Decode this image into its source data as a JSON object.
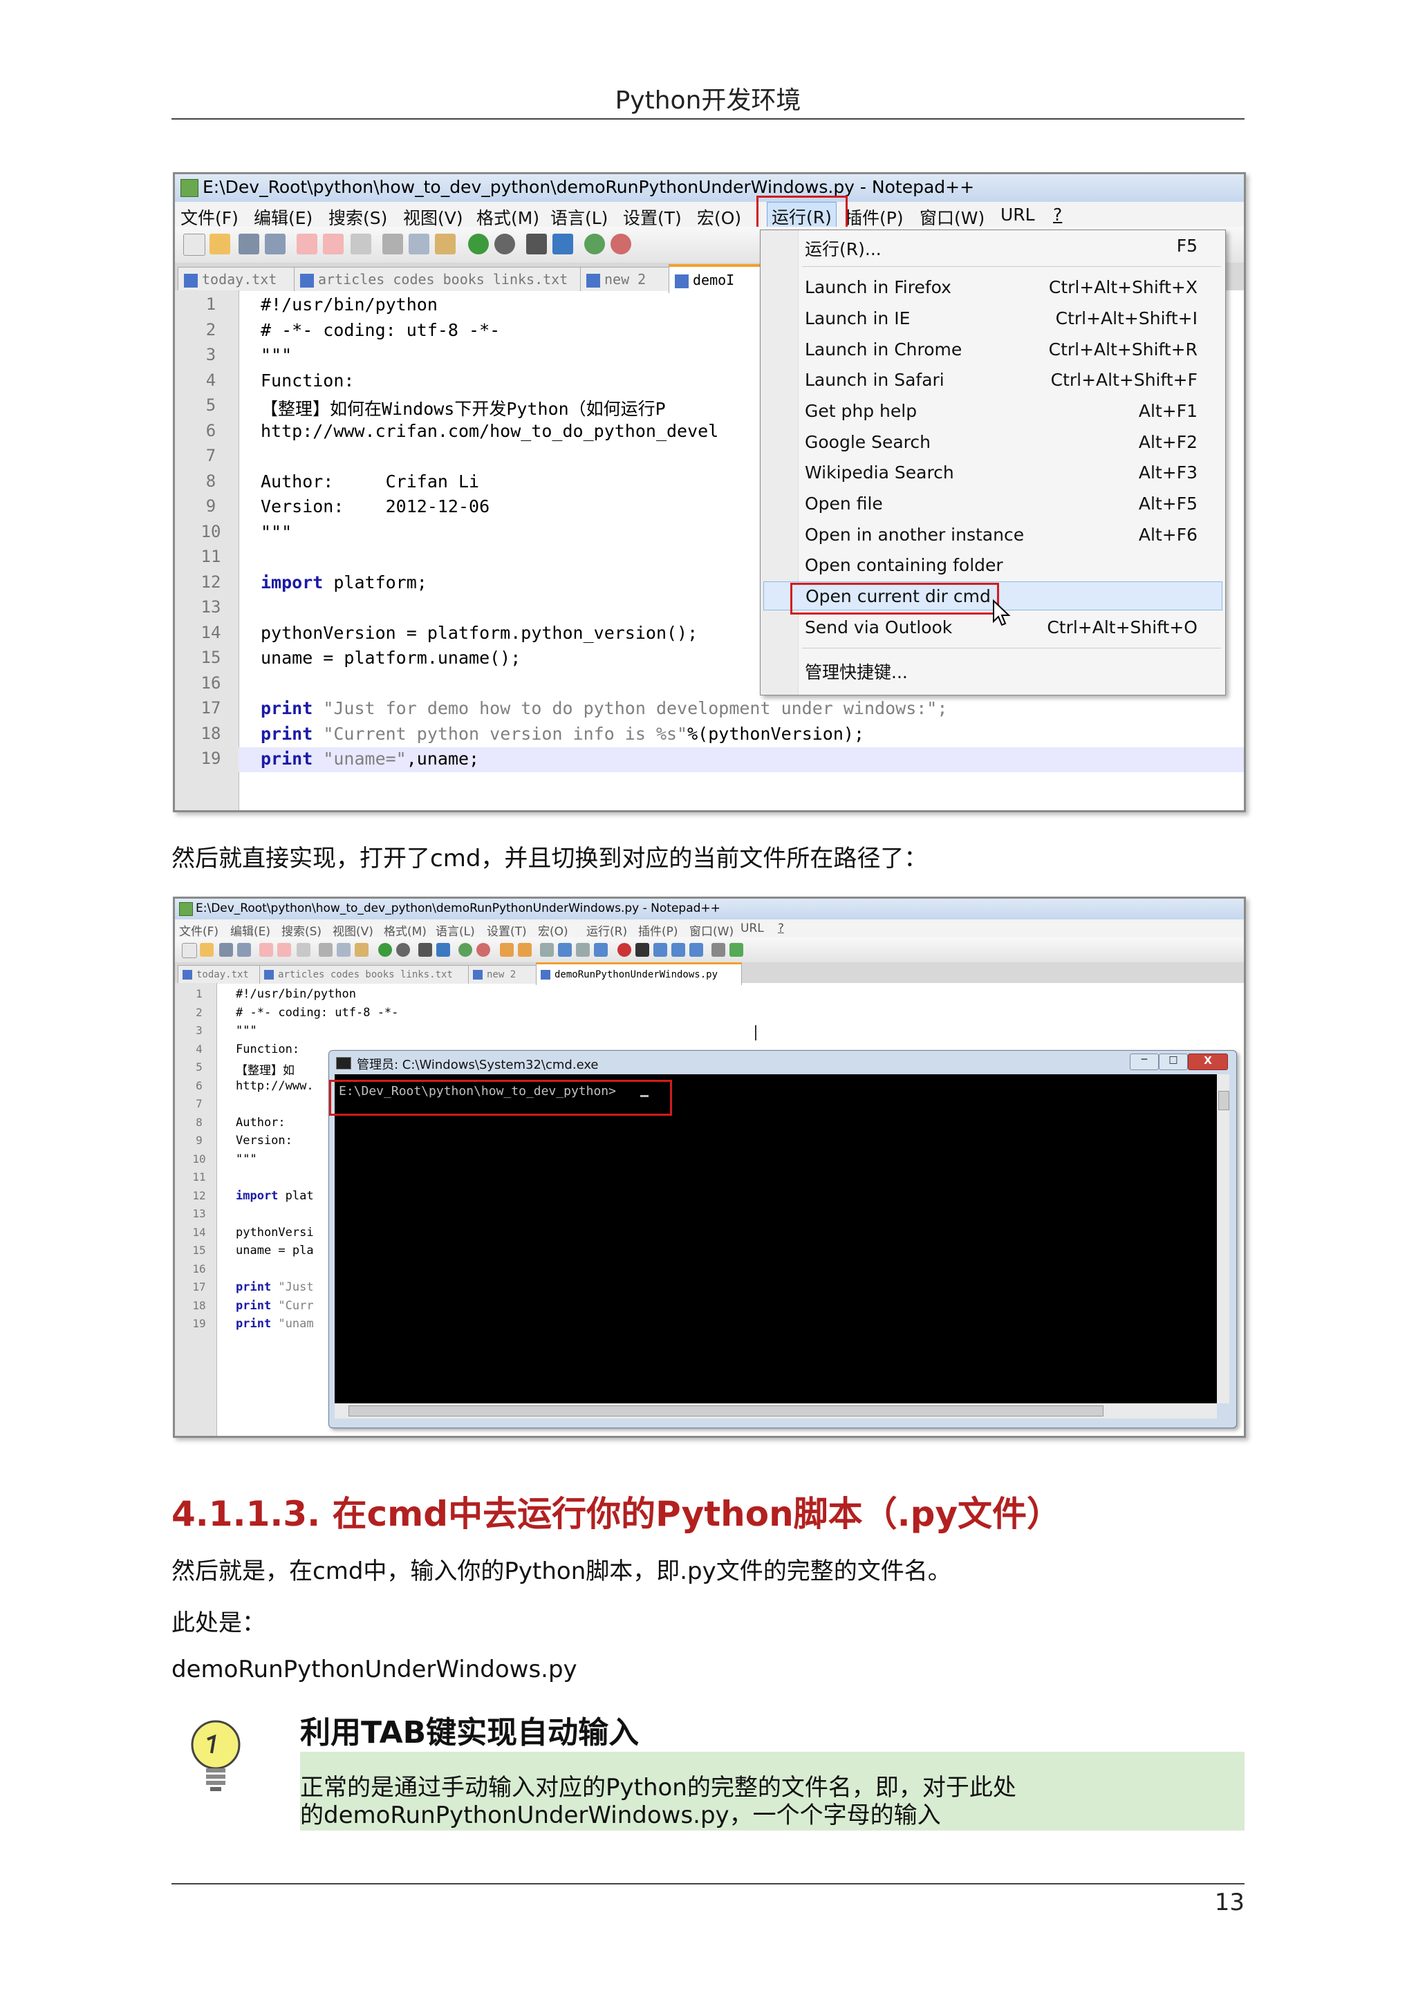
{
  "page": {
    "header": "Python开发环境",
    "page_number": "13",
    "para1": "然后就直接实现，打开了cmd，并且切换到对应的当前文件所在路径了：",
    "section_title": "4.1.1.3. 在cmd中去运行你的Python脚本（.py文件）",
    "para2": "然后就是，在cmd中，输入你的Python脚本，即.py文件的完整的文件名。",
    "para3": "此处是：",
    "para4": "demoRunPythonUnderWindows.py",
    "tip_title": "利用TAB键实现自动输入",
    "tip_line1": "正常的是通过手动输入对应的Python的完整的文件名，即，对于此处",
    "tip_line2": "的demoRunPythonUnderWindows.py，一个个字母的输入"
  },
  "shot1": {
    "title": "E:\\Dev_Root\\python\\how_to_dev_python\\demoRunPythonUnderWindows.py - Notepad++",
    "menu": [
      "文件(F)",
      "编辑(E)",
      "搜索(S)",
      "视图(V)",
      "格式(M)",
      "语言(L)",
      "设置(T)",
      "宏(O)",
      "运行(R)",
      "插件(P)",
      "窗口(W)",
      "URL",
      "?"
    ],
    "tabs": [
      "today.txt",
      "articles codes books links.txt",
      "new  2",
      "demoI"
    ],
    "line_numbers": [
      "1",
      "2",
      "3",
      "4",
      "5",
      "6",
      "7",
      "8",
      "9",
      "10",
      "11",
      "12",
      "13",
      "14",
      "15",
      "16",
      "17",
      "18",
      "19"
    ],
    "code": {
      "l1": "#!/usr/bin/python",
      "l2": "# -*- coding: utf-8 -*-",
      "l3": "\"\"\"",
      "l4": "Function:",
      "l5": "【整理】如何在Windows下开发Python（如何运行P",
      "l6": "http://www.crifan.com/how_to_do_python_devel",
      "l8": "Author:     Crifan Li",
      "l9": "Version:    2012-12-06",
      "l10": "\"\"\"",
      "l12a": "import",
      "l12b": " platform;",
      "l14": "pythonVersion = platform.python_version();",
      "l15": "uname = platform.uname();",
      "l17a": "print",
      "l17b": " \"Just for demo how to do python development under windows:\";",
      "l18a": "print",
      "l18b": " \"Current python version info is %s\"",
      "l18c": "%(pythonVersion);",
      "l19a": "print",
      "l19b": " \"uname=\"",
      "l19c": ",uname;"
    },
    "run_menu": [
      {
        "label": "运行(R)...",
        "shortcut": "F5"
      },
      {
        "label": "Launch in Firefox",
        "shortcut": "Ctrl+Alt+Shift+X"
      },
      {
        "label": "Launch in IE",
        "shortcut": "Ctrl+Alt+Shift+I"
      },
      {
        "label": "Launch in Chrome",
        "shortcut": "Ctrl+Alt+Shift+R"
      },
      {
        "label": "Launch in Safari",
        "shortcut": "Ctrl+Alt+Shift+F"
      },
      {
        "label": "Get php help",
        "shortcut": "Alt+F1"
      },
      {
        "label": "Google Search",
        "shortcut": "Alt+F2"
      },
      {
        "label": "Wikipedia Search",
        "shortcut": "Alt+F3"
      },
      {
        "label": "Open file",
        "shortcut": "Alt+F5"
      },
      {
        "label": "Open in another instance",
        "shortcut": "Alt+F6"
      },
      {
        "label": "Open containing folder",
        "shortcut": ""
      },
      {
        "label": "Open current dir cmd",
        "shortcut": ""
      },
      {
        "label": "Send via Outlook",
        "shortcut": "Ctrl+Alt+Shift+O"
      },
      {
        "label": "管理快捷键...",
        "shortcut": ""
      }
    ]
  },
  "shot2": {
    "title": "E:\\Dev_Root\\python\\how_to_dev_python\\demoRunPythonUnderWindows.py - Notepad++",
    "menu": [
      "文件(F)",
      "编辑(E)",
      "搜索(S)",
      "视图(V)",
      "格式(M)",
      "语言(L)",
      "设置(T)",
      "宏(O)",
      "运行(R)",
      "插件(P)",
      "窗口(W)",
      "URL",
      "?"
    ],
    "tabs": [
      "today.txt",
      "articles codes books links.txt",
      "new  2",
      "demoRunPythonUnderWindows.py"
    ],
    "line_numbers": [
      "1",
      "2",
      "3",
      "4",
      "5",
      "6",
      "7",
      "8",
      "9",
      "10",
      "11",
      "12",
      "13",
      "14",
      "15",
      "16",
      "17",
      "18",
      "19"
    ],
    "code": {
      "l1": "#!/usr/bin/python",
      "l2": "# -*- coding: utf-8 -*-",
      "l3": "\"\"\"",
      "l4": "Function:",
      "l5": "【整理】如",
      "l6": "http://www.",
      "l8": "Author:",
      "l9": "Version:",
      "l10": "\"\"\"",
      "l12a": "import",
      "l12b": " plat",
      "l14": "pythonVersi",
      "l15": "uname = pla",
      "l17a": "print",
      "l17b": " \"Just",
      "l18a": "print",
      "l18b": " \"Curr",
      "l19a": "print",
      "l19b": " \"unam"
    },
    "cmd_title": "管理员: C:\\Windows\\System32\\cmd.exe",
    "cmd_prompt": "E:\\Dev_Root\\python\\how_to_dev_python>",
    "cmd_buttons": [
      "─",
      "□",
      "X"
    ]
  }
}
